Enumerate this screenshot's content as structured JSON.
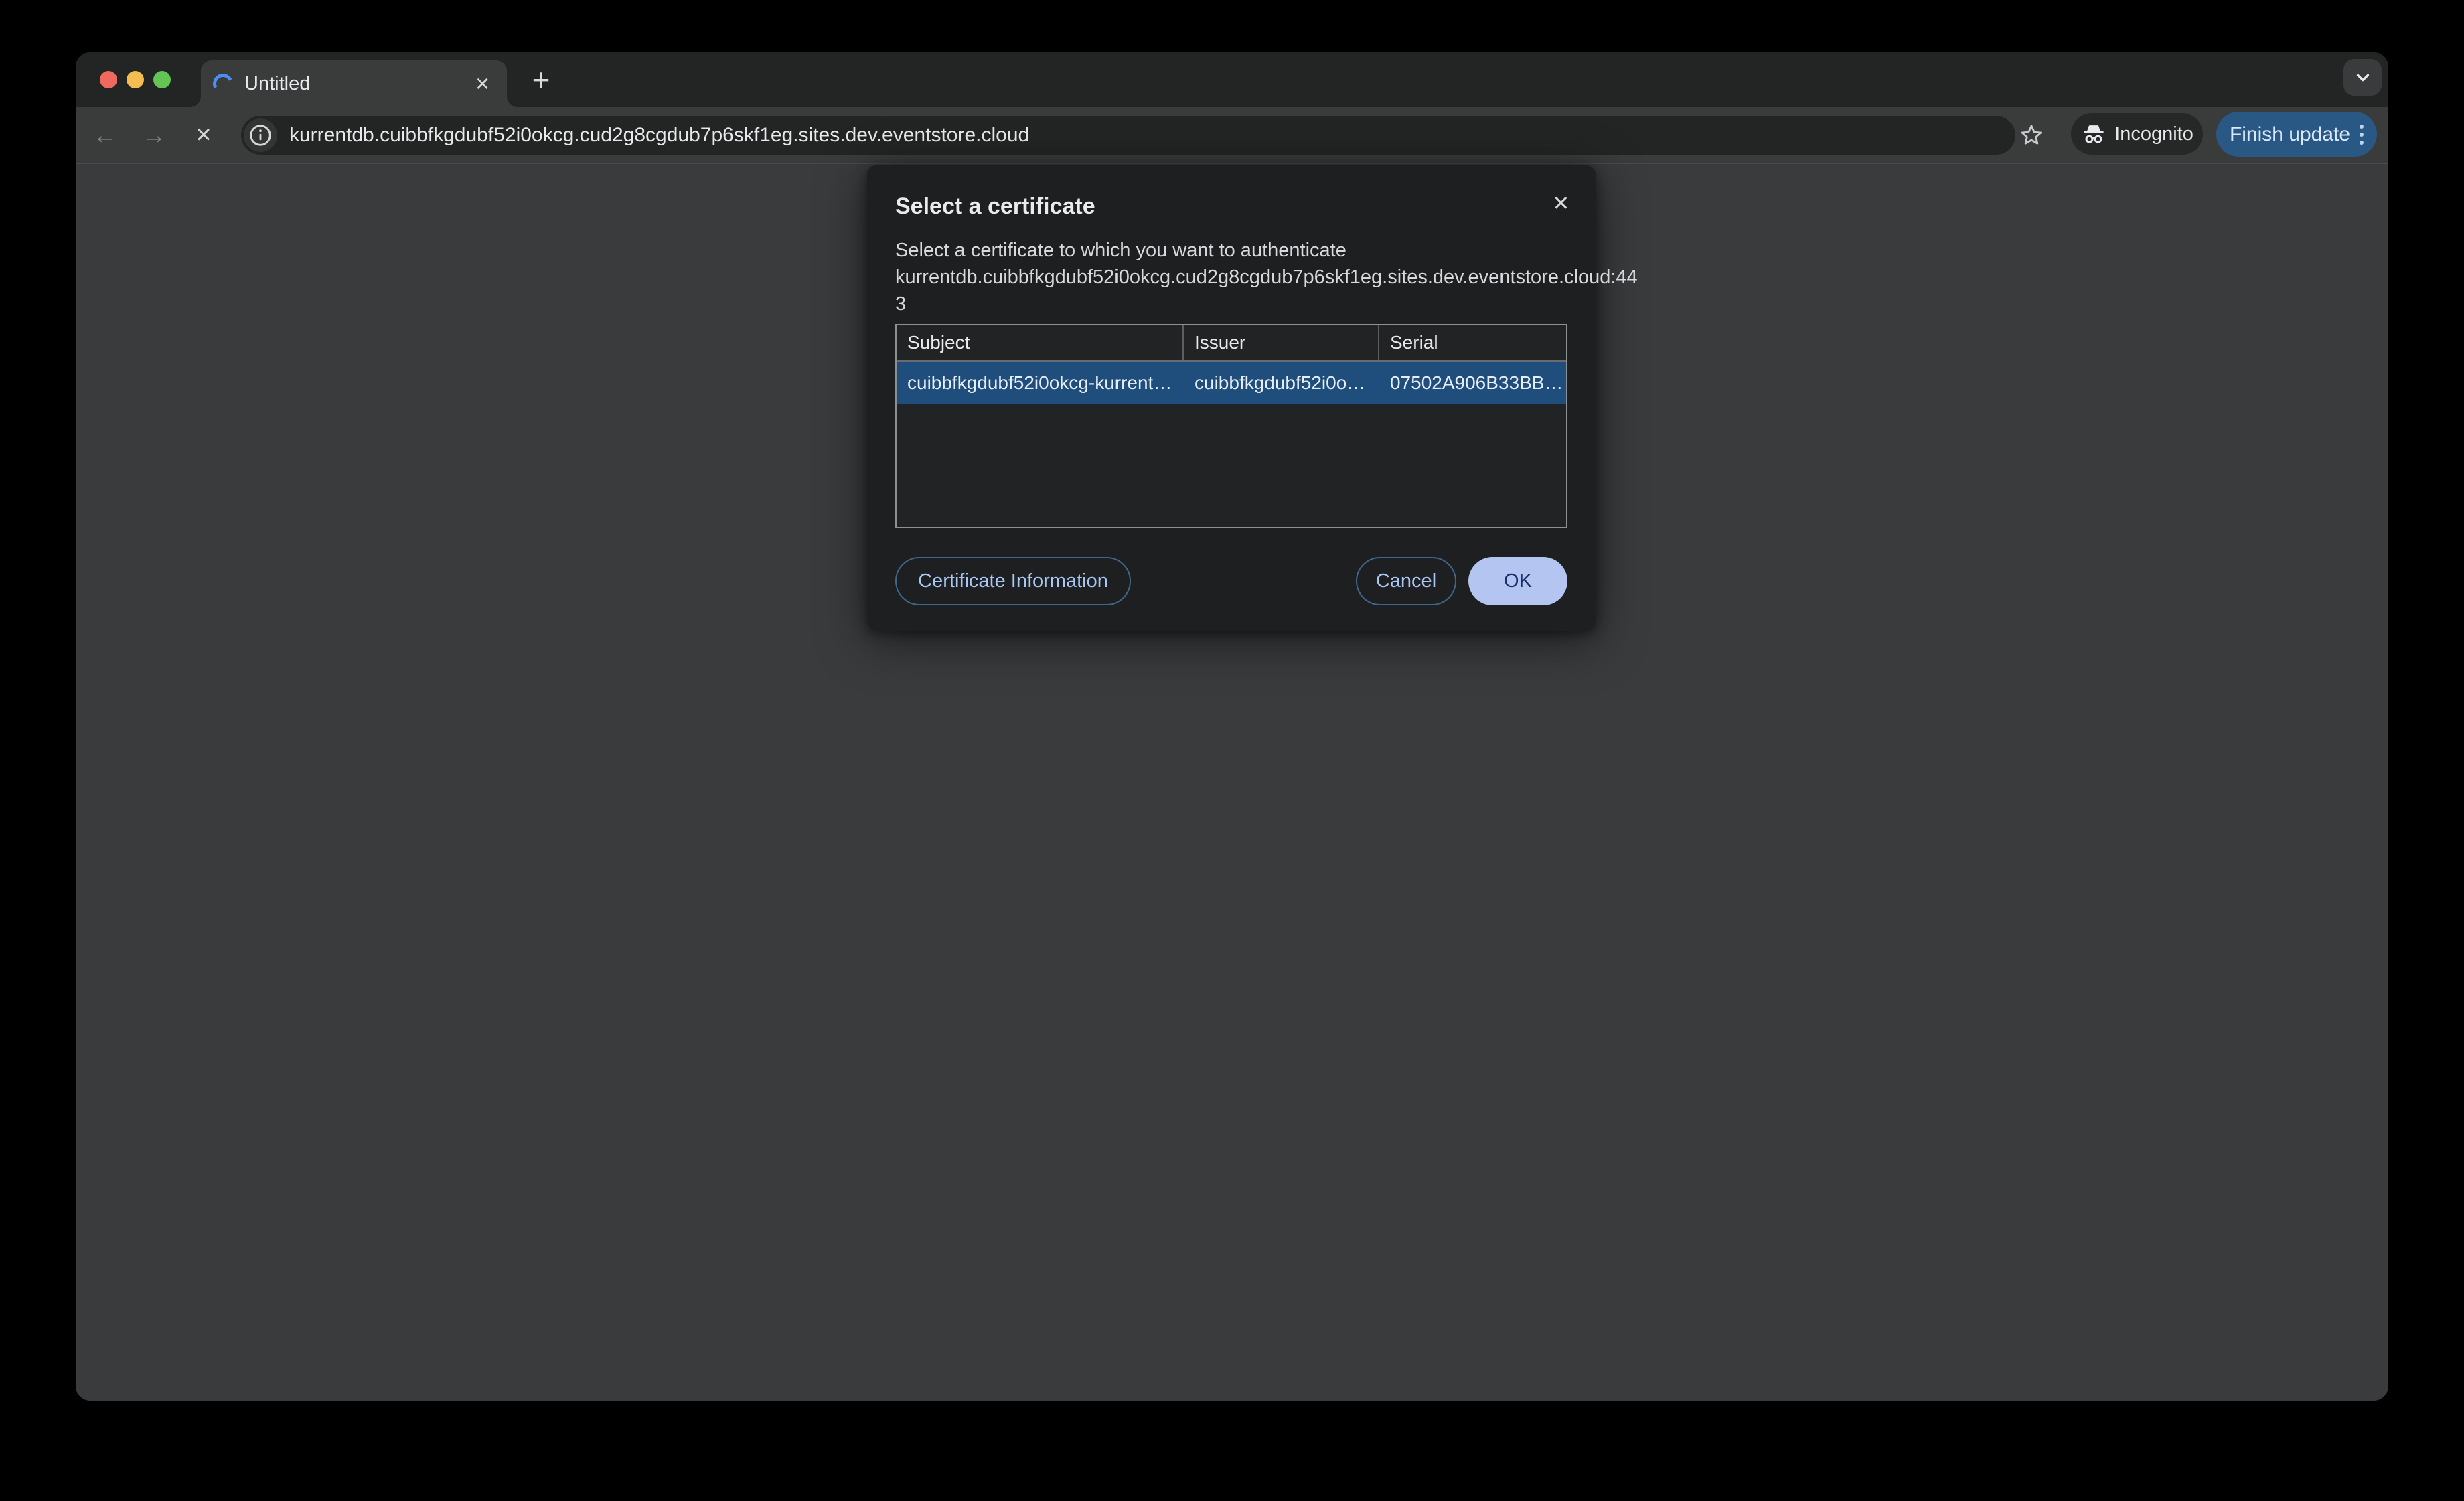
{
  "browser": {
    "traffic_lights": [
      "close",
      "minimize",
      "zoom"
    ],
    "tab": {
      "title": "Untitled",
      "close_icon": "×",
      "loading": true
    },
    "new_tab_icon": "+",
    "toolbar": {
      "back_icon": "←",
      "forward_icon": "→",
      "stop_icon": "×",
      "url": "kurrentdb.cuibbfkgdubf52i0okcg.cud2g8cgdub7p6skf1eg.sites.dev.eventstore.cloud",
      "incognito_label": "Incognito",
      "update_button_label": "Finish update"
    }
  },
  "dialog": {
    "title": "Select a certificate",
    "close_icon": "×",
    "description_lines": {
      "line1": "Select a certificate to which you want to authenticate",
      "line2": "kurrentdb.cuibbfkgdubf52i0okcg.cud2g8cgdub7p6skf1eg.sites.dev.eventstore.cloud:44",
      "line3": "3"
    },
    "table": {
      "columns": [
        "Subject",
        "Issuer",
        "Serial"
      ],
      "rows": [
        {
          "subject": "cuibbfkgdubf52i0okcg-kurrent…",
          "issuer": "cuibbfkgdubf52i0o…",
          "serial": "07502A906B33BB…",
          "selected": true
        }
      ]
    },
    "buttons": {
      "certificate_information": "Certificate Information",
      "cancel": "Cancel",
      "ok": "OK"
    }
  },
  "colors": {
    "selected_row": "#1f4e7d",
    "accent_light_blue": "#a9c7f4",
    "ok_button_bg": "#b3c5f0",
    "update_button_bg": "#2a5884",
    "toolbar_bg": "#3a3b3b",
    "page_bg": "#3a3b3d",
    "dialog_bg": "#1e1f20"
  }
}
